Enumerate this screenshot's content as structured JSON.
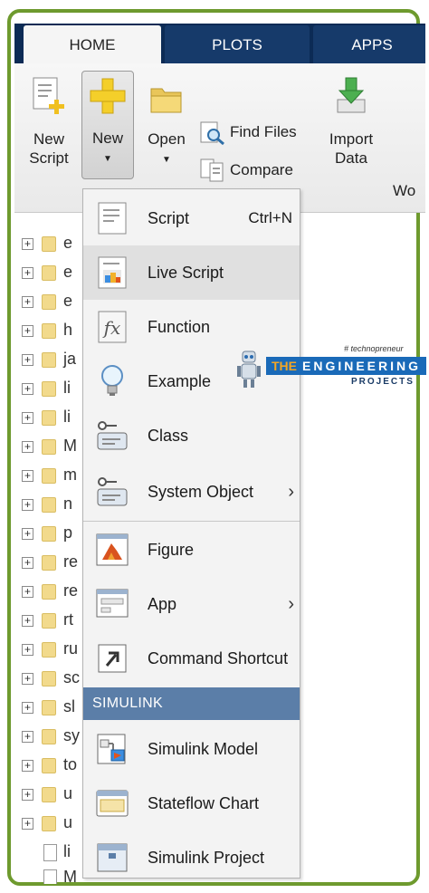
{
  "tabs": [
    {
      "label": "HOME",
      "active": true
    },
    {
      "label": "PLOTS",
      "active": false
    },
    {
      "label": "APPS",
      "active": false
    }
  ],
  "toolstrip": {
    "new_script": {
      "line1": "New",
      "line2": "Script"
    },
    "new": {
      "label": "New",
      "caret": "▼"
    },
    "open": {
      "label": "Open",
      "caret": "▼"
    },
    "find_files": "Find Files",
    "compare": "Compare",
    "import_data": {
      "line1": "Import",
      "line2": "Data"
    },
    "partial_next": "Wo"
  },
  "file_tree": {
    "rows": [
      "e",
      "e",
      "e",
      "h",
      "ja",
      "li",
      "li",
      "M",
      "m",
      "n",
      "p",
      "re",
      "re",
      "rt",
      "ru",
      "sc",
      "sl",
      "sy",
      "to",
      "u",
      "u"
    ],
    "files": [
      "li",
      "M"
    ]
  },
  "menu": {
    "items": [
      {
        "label": "Script",
        "shortcut": "Ctrl+N",
        "icon": "script-icon"
      },
      {
        "label": "Live Script",
        "icon": "live-script-icon"
      },
      {
        "label": "Function",
        "icon": "function-icon"
      },
      {
        "label": "Example",
        "icon": "lightbulb-icon"
      },
      {
        "label": "Class",
        "icon": "class-icon"
      },
      {
        "label": "System Object",
        "icon": "system-object-icon",
        "submenu": "›"
      },
      {
        "label": "Figure",
        "icon": "figure-icon"
      },
      {
        "label": "App",
        "icon": "app-icon",
        "submenu": "›"
      },
      {
        "label": "Command Shortcut",
        "icon": "shortcut-icon"
      }
    ],
    "section_label": "SIMULINK",
    "simulink_items": [
      {
        "label": "Simulink Model",
        "icon": "simulink-model-icon"
      },
      {
        "label": "Stateflow Chart",
        "icon": "stateflow-chart-icon"
      },
      {
        "label": "Simulink Project",
        "icon": "simulink-project-icon"
      }
    ]
  },
  "watermark": {
    "tag": "# technopreneur",
    "the": "THE",
    "main": "ENGINEERING",
    "sub": "PROJECTS"
  },
  "colors": {
    "frame": "#6e9a2e",
    "tabbar": "#0c2b55",
    "section": "#5b7ea8",
    "menu_bg": "#f3f3f3"
  }
}
